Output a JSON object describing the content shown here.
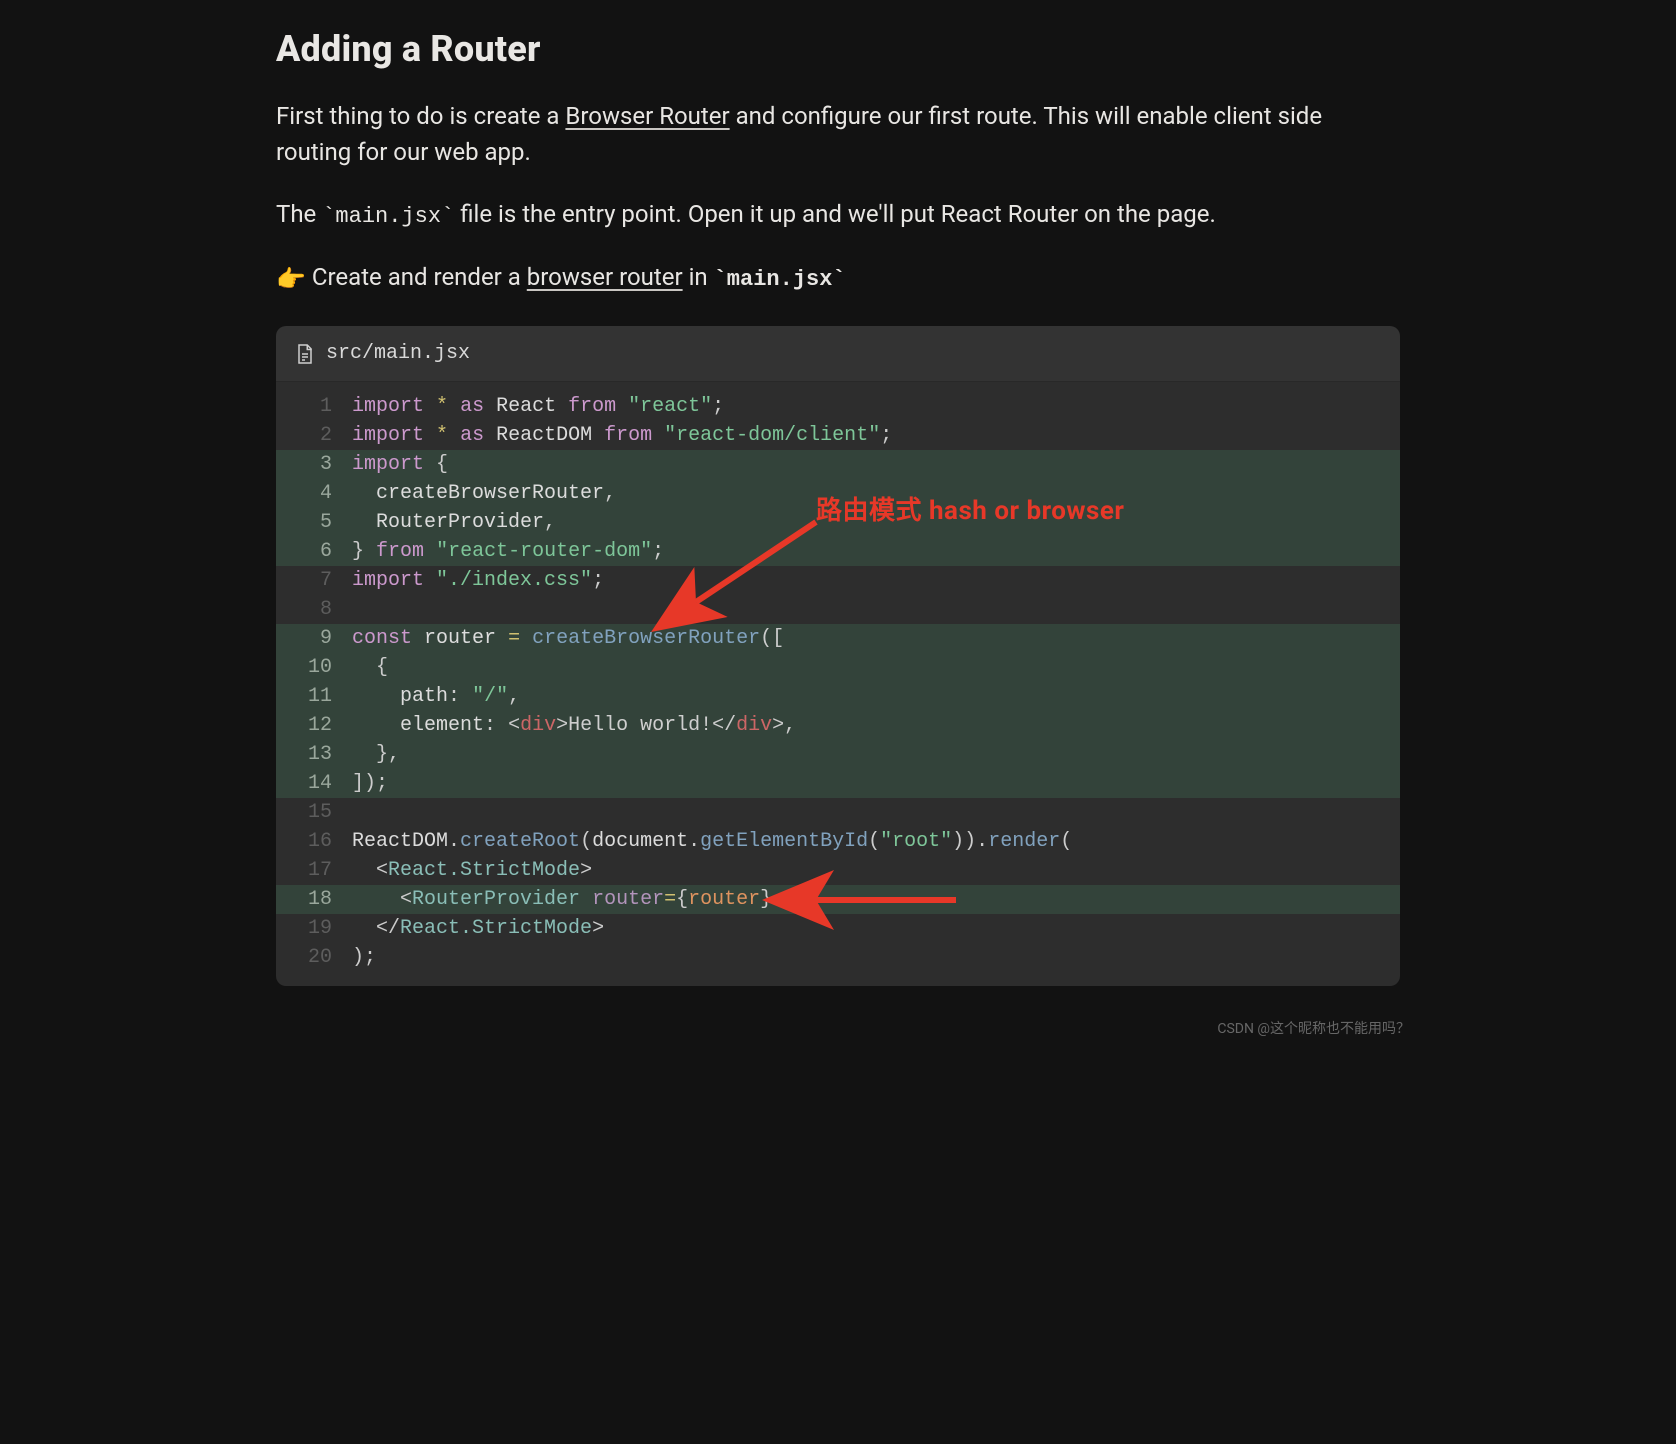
{
  "heading": "Adding a Router",
  "para1_pre": "First thing to do is create a ",
  "para1_link": "Browser Router",
  "para1_post": " and configure our first route. This will enable client side routing for our web app.",
  "para2_pre": "The ",
  "para2_code": "`main.jsx`",
  "para2_post": " file is the entry point. Open it up and we'll put React Router on the page.",
  "cta_emoji": "👉",
  "cta_pre": "Create and render a ",
  "cta_link": "browser router",
  "cta_mid": " in ",
  "cta_code": "`main.jsx`",
  "file_path": "src/main.jsx",
  "annotation_text": "路由模式  hash or browser",
  "watermark": "CSDN @这个昵称也不能用吗？",
  "code_lines": [
    {
      "n": 1,
      "hl": false,
      "html": "<span class='t-kw'>import</span> <span class='t-op'>*</span> <span class='t-kw'>as</span> <span class='t-id'>React</span> <span class='t-kw'>from</span> <span class='t-str'>\"react\"</span><span class='t-pun'>;</span>"
    },
    {
      "n": 2,
      "hl": false,
      "html": "<span class='t-kw'>import</span> <span class='t-op'>*</span> <span class='t-kw'>as</span> <span class='t-id'>ReactDOM</span> <span class='t-kw'>from</span> <span class='t-str'>\"react-dom/client\"</span><span class='t-pun'>;</span>"
    },
    {
      "n": 3,
      "hl": true,
      "html": "<span class='t-kw'>import</span> <span class='t-pun'>{</span>"
    },
    {
      "n": 4,
      "hl": true,
      "html": "  <span class='t-id'>createBrowserRouter</span><span class='t-pun'>,</span>"
    },
    {
      "n": 5,
      "hl": true,
      "html": "  <span class='t-id'>RouterProvider</span><span class='t-pun'>,</span>"
    },
    {
      "n": 6,
      "hl": true,
      "html": "<span class='t-pun'>}</span> <span class='t-kw'>from</span> <span class='t-str'>\"react-router-dom\"</span><span class='t-pun'>;</span>"
    },
    {
      "n": 7,
      "hl": false,
      "html": "<span class='t-kw'>import</span> <span class='t-str'>\"./index.css\"</span><span class='t-pun'>;</span>"
    },
    {
      "n": 8,
      "hl": false,
      "html": ""
    },
    {
      "n": 9,
      "hl": true,
      "html": "<span class='t-kw'>const</span> <span class='t-var'>router</span> <span class='t-op'>=</span> <span class='t-fn'>createBrowserRouter</span><span class='t-pun'>([</span>"
    },
    {
      "n": 10,
      "hl": true,
      "html": "  <span class='t-pun'>{</span>"
    },
    {
      "n": 11,
      "hl": true,
      "html": "    <span class='t-id'>path</span><span class='t-pun'>:</span> <span class='t-str'>\"/\"</span><span class='t-pun'>,</span>"
    },
    {
      "n": 12,
      "hl": true,
      "html": "    <span class='t-id'>element</span><span class='t-pun'>:</span> <span class='t-pun'>&lt;</span><span class='t-tag'>div</span><span class='t-pun'>&gt;</span>Hello world!<span class='t-pun'>&lt;/</span><span class='t-tag'>div</span><span class='t-pun'>&gt;,</span>"
    },
    {
      "n": 13,
      "hl": true,
      "html": "  <span class='t-pun'>},</span>"
    },
    {
      "n": 14,
      "hl": true,
      "html": "<span class='t-pun'>]);</span>"
    },
    {
      "n": 15,
      "hl": false,
      "html": ""
    },
    {
      "n": 16,
      "hl": false,
      "html": "<span class='t-id'>ReactDOM</span><span class='t-pun'>.</span><span class='t-fn'>createRoot</span><span class='t-pun'>(</span><span class='t-id'>document</span><span class='t-pun'>.</span><span class='t-fn'>getElementById</span><span class='t-pun'>(</span><span class='t-str'>\"root\"</span><span class='t-pun'>)).</span><span class='t-fn'>render</span><span class='t-pun'>(</span>"
    },
    {
      "n": 17,
      "hl": false,
      "html": "  <span class='t-pun'>&lt;</span><span class='t-cls'>React.StrictMode</span><span class='t-pun'>&gt;</span>"
    },
    {
      "n": 18,
      "hl": true,
      "html": "    <span class='t-pun'>&lt;</span><span class='t-cls'>RouterProvider</span> <span class='t-jsxattr'>router</span><span class='t-op'>=</span><span class='t-pun'>{</span><span class='t-router'>router</span><span class='t-pun'>}</span> <span class='t-pun'>/&gt;</span>"
    },
    {
      "n": 19,
      "hl": false,
      "html": "  <span class='t-pun'>&lt;/</span><span class='t-cls'>React.StrictMode</span><span class='t-pun'>&gt;</span>"
    },
    {
      "n": 20,
      "hl": false,
      "html": "<span class='t-pun'>);</span>"
    }
  ]
}
